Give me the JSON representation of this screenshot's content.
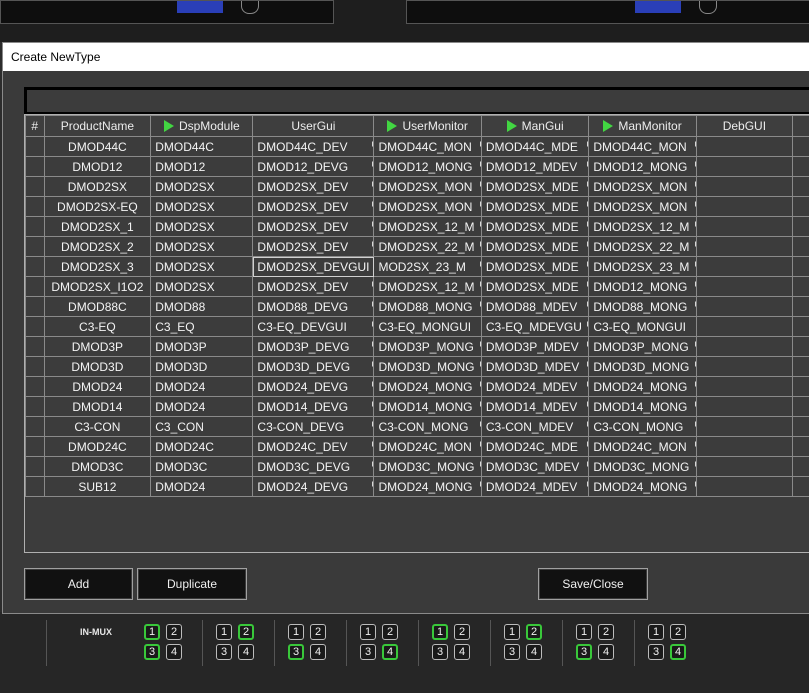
{
  "dialog": {
    "title": "Create NewType",
    "buttons": {
      "add": "Add",
      "duplicate": "Duplicate",
      "save_close": "Save/Close"
    }
  },
  "grid": {
    "columns": [
      {
        "key": "num",
        "label": "#",
        "arrow": false
      },
      {
        "key": "product",
        "label": "ProductName",
        "arrow": false
      },
      {
        "key": "dsp",
        "label": "DspModule",
        "arrow": true
      },
      {
        "key": "usergui",
        "label": "UserGui",
        "arrow": false
      },
      {
        "key": "usermon",
        "label": "UserMonitor",
        "arrow": true
      },
      {
        "key": "mangui",
        "label": "ManGui",
        "arrow": true
      },
      {
        "key": "manmon",
        "label": "ManMonitor",
        "arrow": true
      },
      {
        "key": "debgui",
        "label": "DebGUI",
        "arrow": false
      }
    ],
    "rows": [
      {
        "product": "DMOD44C",
        "dsp": "DMOD44C",
        "usergui": "DMOD44C_DEV",
        "usermon": "DMOD44C_MON",
        "mangui": "DMOD44C_MDE",
        "manmon": "DMOD44C_MON",
        "debgui": ""
      },
      {
        "product": "DMOD12",
        "dsp": "DMOD12",
        "usergui": "DMOD12_DEVG",
        "usermon": "DMOD12_MONG",
        "mangui": "DMOD12_MDEV",
        "manmon": "DMOD12_MONG",
        "debgui": ""
      },
      {
        "product": "DMOD2SX",
        "dsp": "DMOD2SX",
        "usergui": "DMOD2SX_DEV",
        "usermon": "DMOD2SX_MON",
        "mangui": "DMOD2SX_MDE",
        "manmon": "DMOD2SX_MON",
        "debgui": ""
      },
      {
        "product": "DMOD2SX-EQ",
        "dsp": "DMOD2SX",
        "usergui": "DMOD2SX_DEV",
        "usermon": "DMOD2SX_MON",
        "mangui": "DMOD2SX_MDE",
        "manmon": "DMOD2SX_MON",
        "debgui": ""
      },
      {
        "product": "DMOD2SX_1",
        "dsp": "DMOD2SX",
        "usergui": "DMOD2SX_DEV",
        "usermon": "DMOD2SX_12_M",
        "mangui": "DMOD2SX_MDE",
        "manmon": "DMOD2SX_12_M",
        "debgui": ""
      },
      {
        "product": "DMOD2SX_2",
        "dsp": "DMOD2SX",
        "usergui": "DMOD2SX_DEV",
        "usermon": "DMOD2SX_22_M",
        "mangui": "DMOD2SX_MDE",
        "manmon": "DMOD2SX_22_M",
        "debgui": ""
      },
      {
        "product": "DMOD2SX_3",
        "dsp": "DMOD2SX",
        "usergui": "DMOD2SX_DEVGUI",
        "usermon": "MOD2SX_23_M",
        "mangui": "DMOD2SX_MDE",
        "manmon": "DMOD2SX_23_M",
        "debgui": ""
      },
      {
        "product": "DMOD2SX_I1O2",
        "dsp": "DMOD2SX",
        "usergui": "DMOD2SX_DEV",
        "usermon": "DMOD2SX_12_M",
        "mangui": "DMOD2SX_MDE",
        "manmon": "DMOD12_MONG",
        "debgui": ""
      },
      {
        "product": "DMOD88C",
        "dsp": "DMOD88",
        "usergui": "DMOD88_DEVG",
        "usermon": "DMOD88_MONG",
        "mangui": "DMOD88_MDEV",
        "manmon": "DMOD88_MONG",
        "debgui": ""
      },
      {
        "product": "C3-EQ",
        "dsp": "C3_EQ",
        "usergui": "C3-EQ_DEVGUI",
        "usermon": "C3-EQ_MONGUI",
        "mangui": "C3-EQ_MDEVGU",
        "manmon": "C3-EQ_MONGUI",
        "debgui": ""
      },
      {
        "product": "DMOD3P",
        "dsp": "DMOD3P",
        "usergui": "DMOD3P_DEVG",
        "usermon": "DMOD3P_MONG",
        "mangui": "DMOD3P_MDEV",
        "manmon": "DMOD3P_MONG",
        "debgui": ""
      },
      {
        "product": "DMOD3D",
        "dsp": "DMOD3D",
        "usergui": "DMOD3D_DEVG",
        "usermon": "DMOD3D_MONG",
        "mangui": "DMOD3D_MDEV",
        "manmon": "DMOD3D_MONG",
        "debgui": ""
      },
      {
        "product": "DMOD24",
        "dsp": "DMOD24",
        "usergui": "DMOD24_DEVG",
        "usermon": "DMOD24_MONG",
        "mangui": "DMOD24_MDEV",
        "manmon": "DMOD24_MONG",
        "debgui": ""
      },
      {
        "product": "DMOD14",
        "dsp": "DMOD24",
        "usergui": "DMOD14_DEVG",
        "usermon": "DMOD14_MONG",
        "mangui": "DMOD14_MDEV",
        "manmon": "DMOD14_MONG",
        "debgui": ""
      },
      {
        "product": "C3-CON",
        "dsp": "C3_CON",
        "usergui": "C3-CON_DEVG",
        "usermon": "C3-CON_MONG",
        "mangui": "C3-CON_MDEV",
        "manmon": "C3-CON_MONG",
        "debgui": ""
      },
      {
        "product": "DMOD24C",
        "dsp": "DMOD24C",
        "usergui": "DMOD24C_DEV",
        "usermon": "DMOD24C_MON",
        "mangui": "DMOD24C_MDE",
        "manmon": "DMOD24C_MON",
        "debgui": ""
      },
      {
        "product": "DMOD3C",
        "dsp": "DMOD3C",
        "usergui": "DMOD3C_DEVG",
        "usermon": "DMOD3C_MONG",
        "mangui": "DMOD3C_MDEV",
        "manmon": "DMOD3C_MONG",
        "debgui": ""
      },
      {
        "product": "SUB12",
        "dsp": "DMOD24",
        "usergui": "DMOD24_DEVG",
        "usermon": "DMOD24_MONG",
        "mangui": "DMOD24_MDEV",
        "manmon": "DMOD24_MONG",
        "debgui": ""
      }
    ]
  },
  "background": {
    "mux_label": "IN-MUX",
    "mux_groups": [
      {
        "active": [
          1,
          3
        ]
      },
      {
        "active": [
          2
        ]
      },
      {
        "active": [
          3
        ]
      },
      {
        "active": [
          4
        ]
      },
      {
        "active": [
          1
        ]
      },
      {
        "active": [
          2
        ]
      },
      {
        "active": [
          3
        ]
      },
      {
        "active": [
          4
        ]
      }
    ],
    "mux_digits": [
      "1",
      "2",
      "3",
      "4"
    ]
  },
  "colors": {
    "accent_green": "#42d642",
    "selected_outline": "#d0d0d0",
    "background": "#2c2c2c"
  }
}
